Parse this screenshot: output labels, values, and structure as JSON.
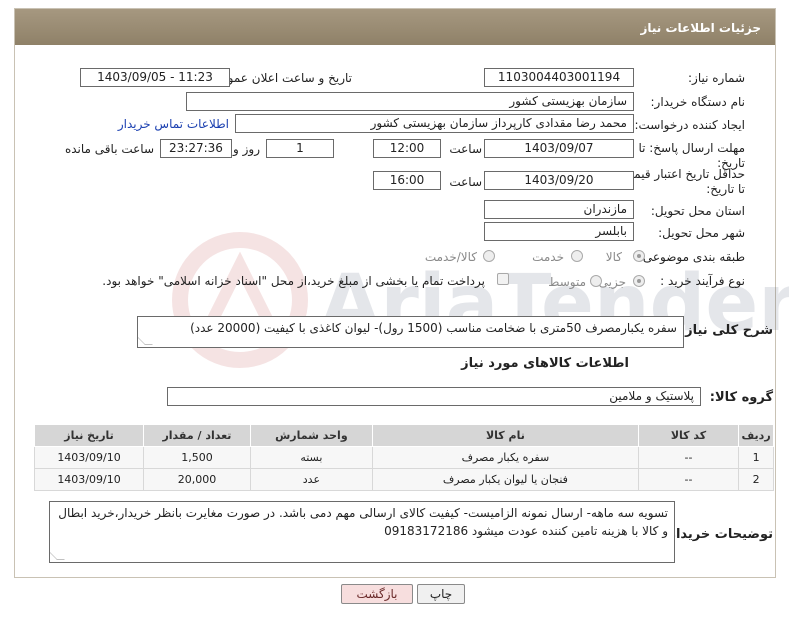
{
  "header": {
    "title": "جزئیات اطلاعات نیاز"
  },
  "form": {
    "need_number_label": "شماره نیاز:",
    "need_number": "1103004403001194",
    "announce_label": "تاریخ و ساعت اعلان عمومی:",
    "announce_value": "1403/09/05 - 11:23",
    "buyer_org_label": "نام دستگاه خریدار:",
    "buyer_org": "سازمان بهزیستی کشور",
    "creator_label": "ایجاد کننده درخواست:",
    "creator": "محمد رضا  مقدادی کارپرداز سازمان بهزیستی کشور",
    "contact_link": "اطلاعات تماس خریدار",
    "reply_deadline_label": "مهلت ارسال پاسخ: تا تاریخ:",
    "reply_date": "1403/09/07",
    "time_word": "ساعت",
    "reply_time": "12:00",
    "days_value": "1",
    "days_word": "روز و",
    "remaining_time": "23:27:36",
    "remaining_label": "ساعت باقی مانده",
    "price_deadline_label": "حداقل تاریخ اعتبار قیمت: تا تاریخ:",
    "price_date": "1403/09/20",
    "price_time": "16:00",
    "province_label": "استان محل تحویل:",
    "province": "مازندران",
    "city_label": "شهر محل تحویل:",
    "city": "بابلسر",
    "category_label": "طبقه بندی موضوعی:",
    "category_options": [
      "کالا",
      "خدمت",
      "کالا/خدمت"
    ],
    "purchase_type_label": "نوع فرآیند خرید :",
    "purchase_options": [
      "جزیی",
      "متوسط"
    ],
    "payment_note": "پرداخت تمام یا بخشی از مبلغ خرید،از محل \"اسناد خزانه اسلامی\" خواهد بود."
  },
  "description": {
    "label": "شرح کلی نیاز:",
    "text": "سفره یکبارمصرف 50متری با ضخامت مناسب (1500 رول)- لیوان کاغذی با کیفیت (20000 عدد)"
  },
  "goods": {
    "section_title": "اطلاعات کالاهای مورد نیاز",
    "group_label": "گروه کالا:",
    "group_value": "پلاستیک و ملامین",
    "columns": [
      "ردیف",
      "کد کالا",
      "نام کالا",
      "واحد شمارش",
      "تعداد / مقدار",
      "تاریخ نیاز"
    ],
    "rows": [
      [
        "1",
        "--",
        "سفره یکبار مصرف",
        "بسته",
        "1,500",
        "1403/09/10"
      ],
      [
        "2",
        "--",
        "فنجان یا لیوان یکبار مصرف",
        "عدد",
        "20,000",
        "1403/09/10"
      ]
    ]
  },
  "buyer_notes": {
    "label": "توضیحات خریدار:",
    "text": "تسویه سه ماهه- ارسال نمونه الزامیست- کیفیت کالای ارسالی مهم دمی باشد. در صورت مغایرت بانظر خریدار،خرید ابطال و کالا با هزینه تامین کننده عودت میشود 09183172186"
  },
  "buttons": {
    "print": "چاپ",
    "back": "بازگشت"
  },
  "watermark": "AriaTender.net",
  "colors": {
    "header": "#9a8c74",
    "link": "#1a3fb0",
    "back_button": "#f7dede"
  }
}
